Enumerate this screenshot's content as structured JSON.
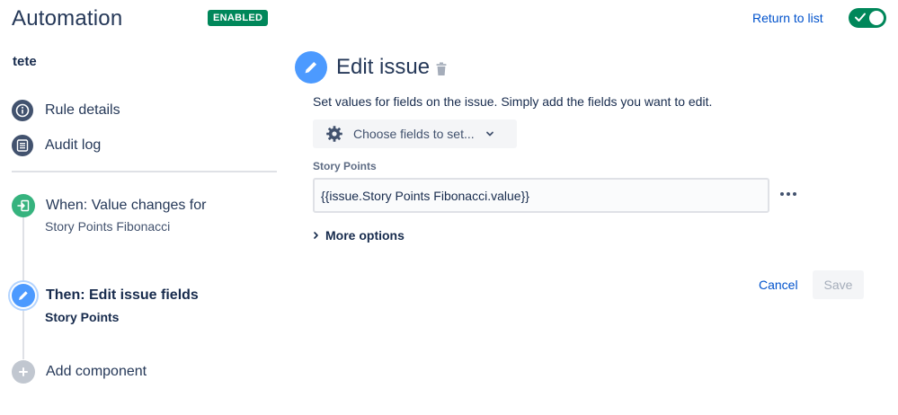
{
  "header": {
    "title": "Automation",
    "status": "ENABLED",
    "return_link": "Return to list",
    "toggle_on": true,
    "accent_color": "#00875a"
  },
  "sidebar": {
    "rule_name": "tete",
    "items": [
      {
        "label": "Rule details",
        "icon": "info-icon"
      },
      {
        "label": "Audit log",
        "icon": "list-icon"
      }
    ],
    "components": [
      {
        "title": "When: Value changes for",
        "subtitle": "Story Points Fibonacci",
        "icon": "trigger-icon",
        "color": "#36b37e"
      },
      {
        "title": "Then: Edit issue fields",
        "subtitle": "Story Points",
        "icon": "pencil-icon",
        "color": "#4c9aff",
        "selected": true
      },
      {
        "title": "Add component",
        "icon": "plus-icon",
        "color": "#c1c7d0"
      }
    ]
  },
  "editor": {
    "title": "Edit issue",
    "description": "Set values for fields on the issue. Simply add the fields you want to edit.",
    "choose_fields_label": "Choose fields to set...",
    "field": {
      "label": "Story Points",
      "value": "{{issue.Story Points Fibonacci.value}}"
    },
    "more_options_label": "More options",
    "cancel_label": "Cancel",
    "save_label": "Save"
  }
}
